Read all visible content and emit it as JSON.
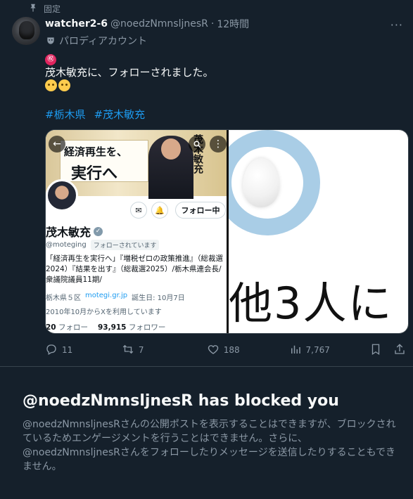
{
  "pinned": {
    "label": "固定"
  },
  "tweet": {
    "display_name": "watcher2-6",
    "handle": "@noedzNmnsljnesR",
    "time": "12時間",
    "parody_label": "パロディアカウント",
    "text_line1": "㊗",
    "text_line2": "茂木敏充に、フォローされました。",
    "hashtags": [
      "#栃木県",
      "#茂木敏充"
    ]
  },
  "left_image": {
    "banner_line1": "経済再生を、",
    "banner_line2": "実行へ",
    "banner_vertical": "茂木敏充",
    "follow_state": "フォロー中",
    "name": "茂木敏充",
    "handle": "@moteging",
    "follows_you": "フォローされています",
    "bio": "「経済再生を実行へ」『増税ゼロの政策推進』（総裁選2024）『結果を出す』（総裁選2025）/栃木県連会長/衆議院議員11期/",
    "location": "栃木県５区",
    "website": "motegi.gr.jp",
    "birthday": "誕生日: 10月7日",
    "joined": "2010年10月からXを利用しています",
    "following_count": "20",
    "following_label": "フォロー",
    "followers_count": "93,915",
    "followers_label": "フォロワー"
  },
  "right_image": {
    "text": "他3人に"
  },
  "actions": {
    "replies": "11",
    "reposts": "7",
    "likes": "188",
    "views": "7,767"
  },
  "blocked": {
    "title": "@noedzNmnsljnesR has blocked you",
    "description": "@noedzNmnsljnesRさんの公開ポストを表示することはできますが、ブロックされているためエンゲージメントを行うことはできません。さらに、@noedzNmnsljnesRさんをフォローしたりメッセージを送信したりすることもできません。"
  },
  "colors": {
    "background": "#15202b",
    "accent": "#1d9bf0",
    "muted": "#8b98a5"
  }
}
